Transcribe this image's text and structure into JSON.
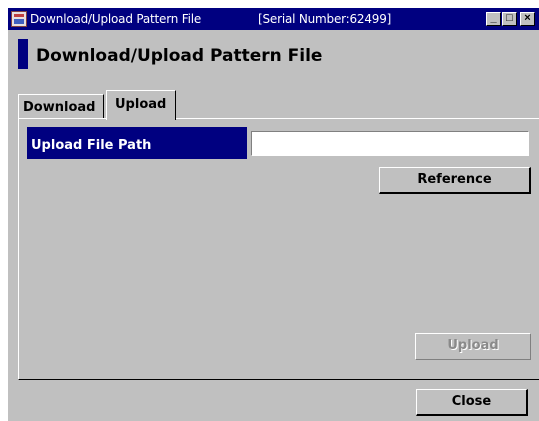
{
  "window": {
    "title": "Download/Upload Pattern File",
    "serial": "[Serial Number:62499]",
    "controls": {
      "minimize": "_",
      "maximize": "□",
      "close": "×"
    }
  },
  "header": {
    "title": "Download/Upload Pattern File"
  },
  "tabs": [
    {
      "label": "Download",
      "active": false
    },
    {
      "label": "Upload",
      "active": true
    }
  ],
  "upload_panel": {
    "path_label": "Upload File Path",
    "path_value": "",
    "reference_label": "Reference",
    "upload_label": "Upload"
  },
  "footer": {
    "close_label": "Close"
  }
}
